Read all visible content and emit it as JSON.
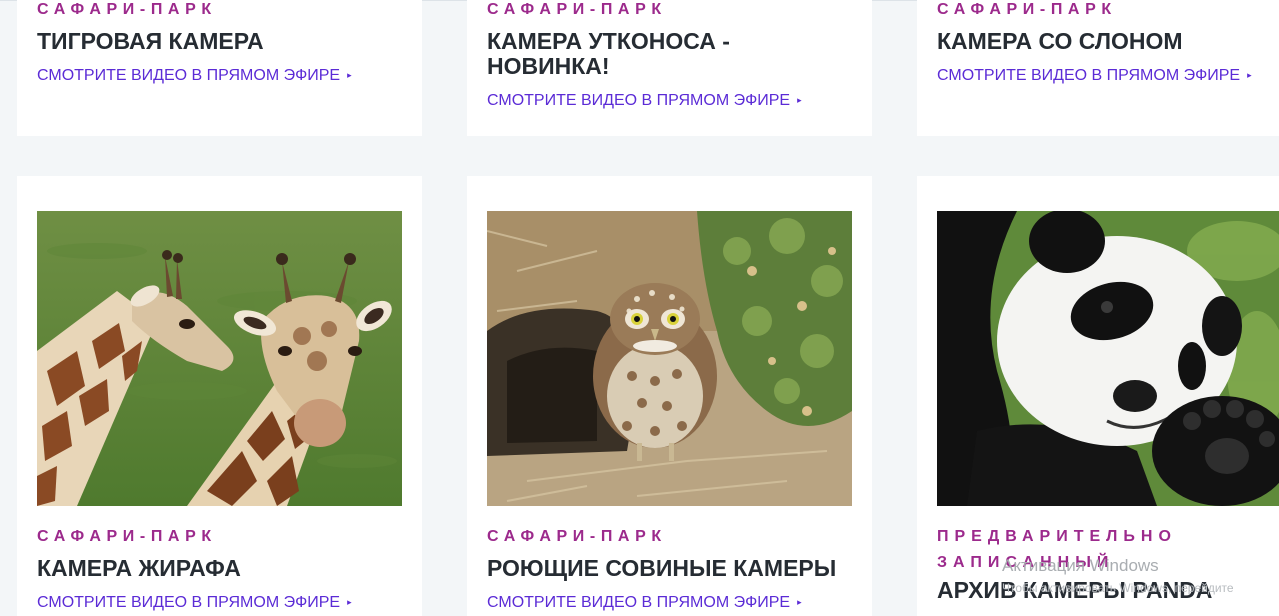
{
  "cards_top": [
    {
      "category": "САФАРИ-ПАРК",
      "title": "ТИГРОВАЯ КАМЕРА",
      "link": "СМОТРИТЕ ВИДЕО В ПРЯМОМ ЭФИРЕ"
    },
    {
      "category": "САФАРИ-ПАРК",
      "title": "КАМЕРА УТКОНОСА - НОВИНКА!",
      "link": "СМОТРИТЕ ВИДЕО В ПРЯМОМ ЭФИРЕ"
    },
    {
      "category": "САФАРИ-ПАРК",
      "title": "КАМЕРА СО СЛОНОМ",
      "link": "СМОТРИТЕ ВИДЕО В ПРЯМОМ ЭФИРЕ"
    }
  ],
  "cards_bottom": [
    {
      "image": "giraffes-photo",
      "category": "САФАРИ-ПАРК",
      "title": "КАМЕРА ЖИРАФА",
      "link": "СМОТРИТЕ ВИДЕО В ПРЯМОМ ЭФИРЕ"
    },
    {
      "image": "burrowing-owl-photo",
      "category": "САФАРИ-ПАРК",
      "title": "РОЮЩИЕ СОВИНЫЕ КАМЕРЫ",
      "link": "СМОТРИТЕ ВИДЕО В ПРЯМОМ ЭФИРЕ"
    },
    {
      "image": "panda-photo",
      "category": "ПРЕДВАРИТЕЛЬНО ЗАПИСАННЫЙ",
      "title": "АРХИВ КАМЕРЫ PANDA",
      "link": ""
    }
  ],
  "watermark": {
    "line1": "Активация Windows",
    "line2": "Чтобы активировать Windows, перейдите"
  },
  "arrow_glyph": "▸",
  "colors": {
    "category": "#9c2a8c",
    "link": "#5b2bd6",
    "title": "#262c33",
    "background": "#f3f6f8"
  }
}
